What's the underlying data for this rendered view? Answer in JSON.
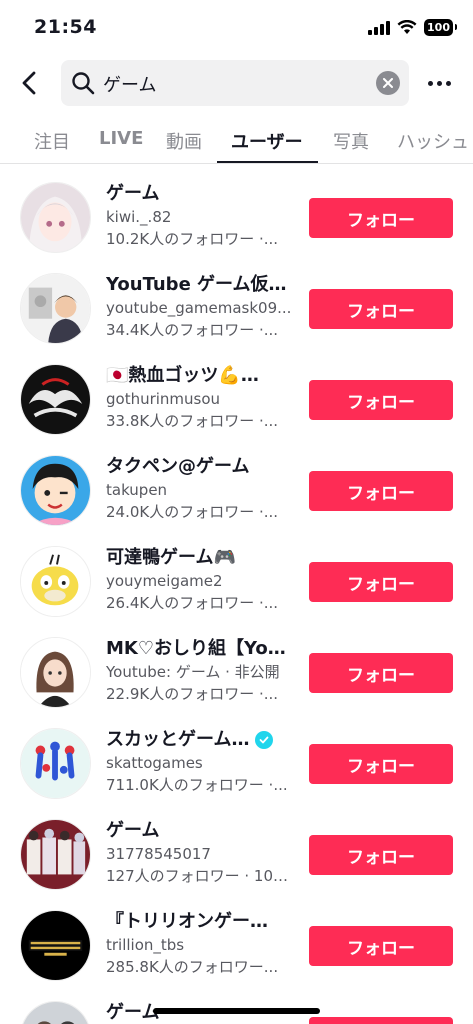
{
  "status_bar": {
    "time": "21:54",
    "battery": "100"
  },
  "search": {
    "query": "ゲーム"
  },
  "tabs": [
    {
      "label": "注目"
    },
    {
      "label": "LIVE"
    },
    {
      "label": "動画"
    },
    {
      "label": "ユーザー",
      "active": true
    },
    {
      "label": "写真"
    },
    {
      "label": "ハッシュ"
    }
  ],
  "follow_label": "フォロー",
  "users": [
    {
      "name": "ゲーム",
      "id": "kiwi._.82",
      "followers": "10.2K人のフォロワー ·..."
    },
    {
      "name": "YouTube ゲーム仮…",
      "id": "youtube_gamemask09...",
      "followers": "34.4K人のフォロワー ·..."
    },
    {
      "name": "🇯🇵熱血ゴッツ💪…",
      "id": "gothurinmusou",
      "followers": "33.8K人のフォロワー ·..."
    },
    {
      "name": "タクペン@ゲーム",
      "id": "takupen",
      "followers": "24.0K人のフォロワー ·..."
    },
    {
      "name": "可達鴨ゲーム🎮",
      "id": "youymeigame2",
      "followers": "26.4K人のフォロワー ·..."
    },
    {
      "name": "MK♡おしり組【Yo…",
      "id": "Youtube: ゲーム · 非公開",
      "followers": "22.9K人のフォロワー ·..."
    },
    {
      "name": "スカッとゲーム…",
      "id": "skattogames",
      "followers": "711.0K人のフォロワー ·...",
      "verified": true
    },
    {
      "name": "ゲーム",
      "id": "31778545017",
      "followers": "127人のフォロワー · 10…"
    },
    {
      "name": "『トリリオンゲー…",
      "id": "trillion_tbs",
      "followers": "285.8K人のフォロワー..."
    },
    {
      "name": "ゲーム",
      "id": "",
      "followers": ""
    }
  ],
  "colors": {
    "follow_button": "#fe2c55",
    "verified": "#20d5ec",
    "secondary_text": "#57585f"
  }
}
